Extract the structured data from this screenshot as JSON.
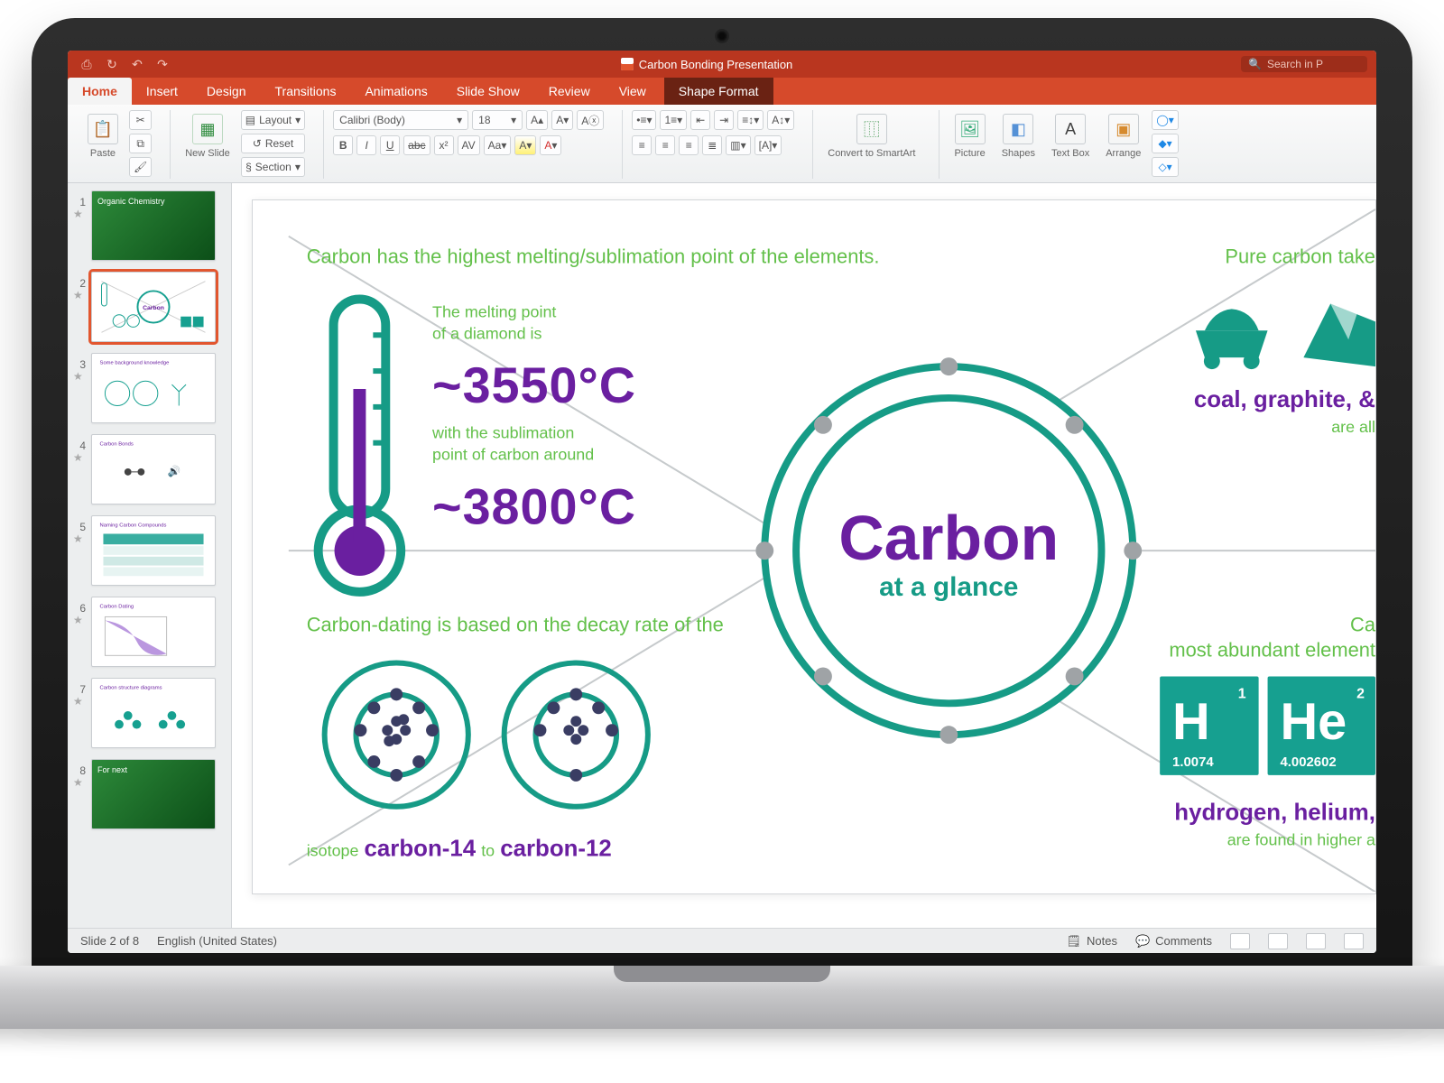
{
  "titlebar": {
    "document_title": "Carbon Bonding Presentation",
    "search_placeholder": "Search in P"
  },
  "tabs": {
    "home": "Home",
    "insert": "Insert",
    "design": "Design",
    "transitions": "Transitions",
    "animations": "Animations",
    "slideshow": "Slide Show",
    "review": "Review",
    "view": "View",
    "shape_format": "Shape Format"
  },
  "ribbon": {
    "paste": "Paste",
    "new_slide": "New Slide",
    "layout": "Layout",
    "reset": "Reset",
    "section": "Section",
    "font_name": "Calibri (Body)",
    "font_size": "18",
    "convert_smartart": "Convert to SmartArt",
    "picture": "Picture",
    "shapes": "Shapes",
    "textbox": "Text Box",
    "arrange": "Arrange"
  },
  "thumbnails": {
    "items": [
      {
        "n": "1",
        "title": "Organic Chemistry"
      },
      {
        "n": "2",
        "title": "Carbon at a glance"
      },
      {
        "n": "3",
        "title": "Some background knowledge"
      },
      {
        "n": "4",
        "title": "Carbon Bonds"
      },
      {
        "n": "5",
        "title": "Naming Carbon Compounds"
      },
      {
        "n": "6",
        "title": "Carbon Dating"
      },
      {
        "n": "7",
        "title": "Carbon structure diagrams"
      },
      {
        "n": "8",
        "title": "For next"
      }
    ]
  },
  "slide": {
    "top_left_caption": "Carbon has the highest melting/sublimation point of the elements.",
    "melt_label_1": "The melting point",
    "melt_label_2": "of a diamond is",
    "melt_value": "~3550°C",
    "sub_label_1": "with the sublimation",
    "sub_label_2": "point of carbon around",
    "sub_value": "~3800°C",
    "top_right_caption": "Pure carbon take",
    "top_right_label": "coal, graphite, & ",
    "top_right_label2": "are all ",
    "center_title": "Carbon",
    "center_sub": "at a glance",
    "bl_caption": "Carbon-dating is based on the decay rate of the",
    "bl_isotope": "isotope",
    "bl_c14": "carbon-14",
    "bl_to": "to",
    "bl_c12": "carbon-12",
    "br_caption_1": "Ca",
    "br_caption_2": "most abundant element",
    "br_h_sym": "H",
    "br_h_num": "1",
    "br_h_mass": "1.0074",
    "br_he_sym": "He",
    "br_he_num": "2",
    "br_he_mass": "4.002602",
    "br_label_1": "hydrogen, helium,",
    "br_label_2": "are found in higher a"
  },
  "statusbar": {
    "slide_indicator": "Slide 2 of 8",
    "language": "English (United States)",
    "notes": "Notes",
    "comments": "Comments"
  }
}
